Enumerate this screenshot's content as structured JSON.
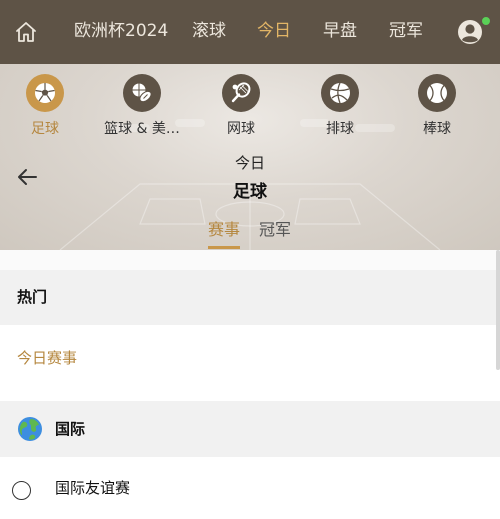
{
  "topnav": {
    "items": [
      {
        "label": "欧洲杯2024",
        "active": false
      },
      {
        "label": "滚球",
        "active": false
      },
      {
        "label": "今日",
        "active": true
      },
      {
        "label": "早盘",
        "active": false
      },
      {
        "label": "冠军",
        "active": false
      }
    ],
    "home_icon": "home-icon",
    "user_icon": "user-icon",
    "online_color": "#5ad157"
  },
  "sports": [
    {
      "label": "足球",
      "icon": "soccer-ball-icon",
      "active": true
    },
    {
      "label": "篮球 & 美…",
      "icon": "basketball-football-icon",
      "active": false
    },
    {
      "label": "网球",
      "icon": "tennis-icon",
      "active": false
    },
    {
      "label": "排球",
      "icon": "volleyball-icon",
      "active": false
    },
    {
      "label": "棒球",
      "icon": "baseball-icon",
      "active": false
    }
  ],
  "hero": {
    "subtitle": "今日",
    "title": "足球"
  },
  "tabs": [
    {
      "label": "赛事",
      "active": true
    },
    {
      "label": "冠军",
      "active": false
    }
  ],
  "sections": {
    "hot": {
      "title": "热门",
      "items": [
        "今日赛事"
      ]
    },
    "international": {
      "title": "国际",
      "icon": "globe-icon",
      "items": [
        "国际友谊赛"
      ]
    }
  },
  "colors": {
    "accent": "#c9974a",
    "nav_bg": "#5e5346",
    "active_text": "#b5873f"
  }
}
